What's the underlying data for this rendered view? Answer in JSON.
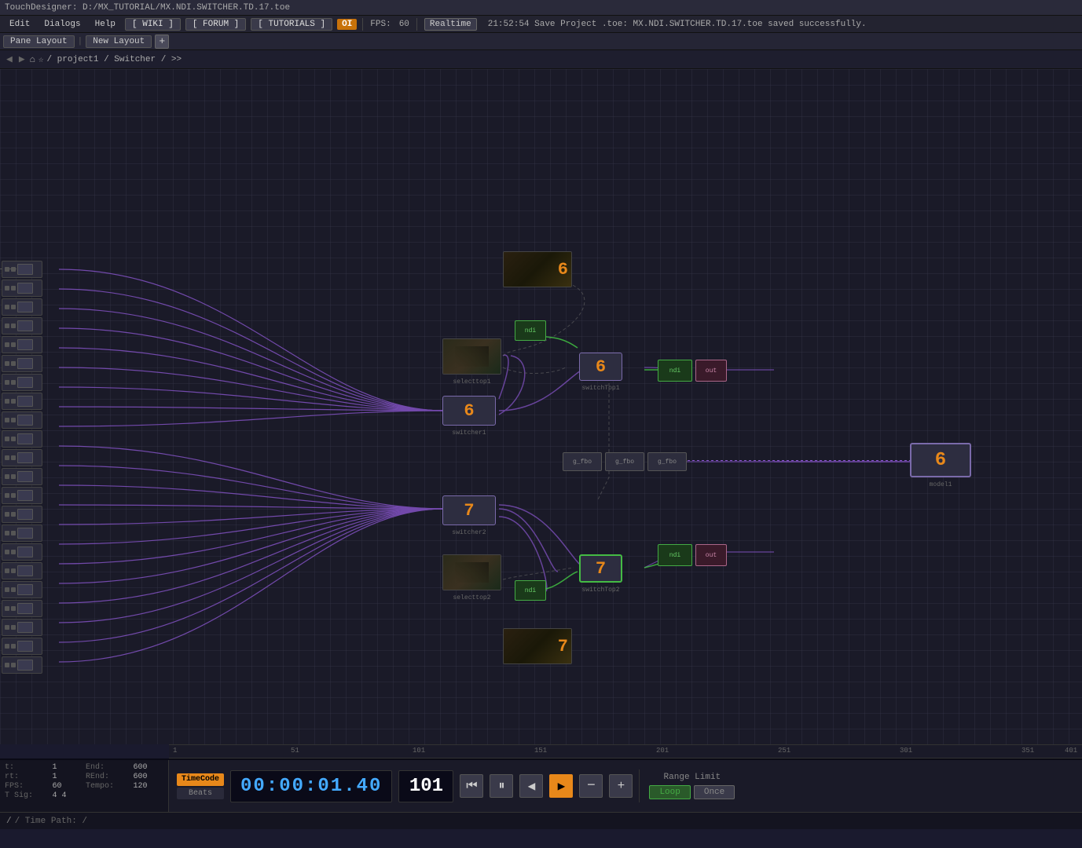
{
  "titlebar": {
    "text": "TouchDesigner: D:/MX_TUTORIAL/MX.NDI.SWITCHER.TD.17.toe"
  },
  "menubar": {
    "edit": "Edit",
    "dialogs": "Dialogs",
    "help": "Help",
    "wiki": "[ WIKI ]",
    "forum": "[ FORUM ]",
    "tutorials": "[ TUTORIALS ]",
    "oi": "OI",
    "fps_label": "FPS:",
    "fps_value": "60",
    "realtime": "Realtime",
    "status": "21:52:54 Save Project .toe: MX.NDI.SWITCHER.TD.17.toe saved successfully."
  },
  "panebar": {
    "pane_layout": "Pane Layout",
    "new_layout": "New Layout",
    "add_icon": "+"
  },
  "navbar": {
    "path": "/ project1 / Switcher / >>"
  },
  "timeline": {
    "marks": [
      "1",
      "51",
      "101",
      "151",
      "201",
      "251",
      "301",
      "351",
      "401"
    ]
  },
  "nodes": {
    "top_video_6": {
      "label": "6",
      "sub": ""
    },
    "mid_preview_top": {
      "label": ""
    },
    "small_green_1": {
      "label": ""
    },
    "num_6_left": {
      "label": "6"
    },
    "num_6_right": {
      "label": "6"
    },
    "num_7_left": {
      "label": "7"
    },
    "num_7_right": {
      "label": "7",
      "selected": true
    },
    "right_6": {
      "label": "6"
    },
    "bot_video_7": {
      "label": "7"
    }
  },
  "stats": {
    "start_label": "t:",
    "start_value": "1",
    "end_label": "End:",
    "end_value": "600",
    "rstart_label": "rt:",
    "rstart_value": "1",
    "rend_label": "REnd:",
    "rend_value": "600",
    "fps_label": "FPS:",
    "fps_value": "60",
    "tempo_label": "Tempo:",
    "tempo_value": "120",
    "tsig_label": "T Sig:",
    "tsig_value": "4    4"
  },
  "transport": {
    "timecode_label": "TimeCode",
    "beats_label": "Beats",
    "timecode_display": "00:00:01.40",
    "frame_display": "101",
    "rewind_icon": "⏮",
    "pause_icon": "⏸",
    "back_icon": "◀",
    "play_icon": "▶",
    "minus_icon": "−",
    "plus_icon": "+",
    "range_limit": "Range Limit",
    "loop": "Loop",
    "once": "Once"
  },
  "pathbar": {
    "text": "/ Time Path: /"
  }
}
